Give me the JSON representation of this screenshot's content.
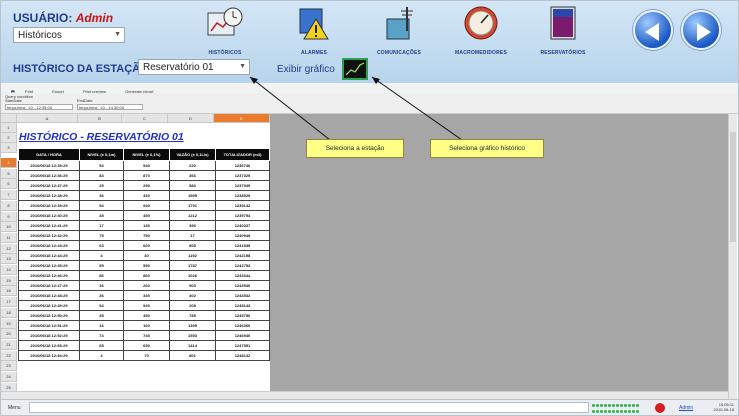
{
  "header": {
    "user_label": "USUÁRIO:",
    "user_name": "Admin",
    "screen_select": "Históricos",
    "station_title": "HISTÓRICO DA ESTAÇÃO -",
    "station_select": "Reservatório 01",
    "exibir_label": "Exibir gráfico",
    "nav": [
      {
        "label": "HISTÓRICOS",
        "icon": "history-chart-icon"
      },
      {
        "label": "ALARMES",
        "icon": "alarm-warning-icon"
      },
      {
        "label": "COMUNICAÇÕES",
        "icon": "antenna-tower-icon"
      },
      {
        "label": "MACROMEDIDORES",
        "icon": "gauge-meter-icon"
      },
      {
        "label": "RESERVATÓRIOS",
        "icon": "tank-icon"
      }
    ]
  },
  "toolbar": {
    "print": "Print",
    "export": "Export",
    "preview": "Print preview",
    "generate": "Generate report",
    "query_condition": "Query condition",
    "start_date_label": "StartDate",
    "end_date_label": "EndDate",
    "start_date": "terça-feira , 10 - 12:35:00",
    "end_date": "terça-feira , 10 - 14:30:00"
  },
  "sheet": {
    "columns": [
      "A",
      "B",
      "C",
      "D",
      "E"
    ],
    "title": "HISTÓRICO - RESERVATÓRIO 01",
    "headers": [
      "DATA / HORA",
      "NIVEL (± 0,1m)",
      "NIVEL (± 0,1%)",
      "VAZÃO (± 0,1L/s)",
      "TOTALIZADOR (m3)"
    ],
    "row_numbers": [
      "1",
      "2",
      "3",
      "4",
      "5",
      "6",
      "7",
      "8",
      "9",
      "10",
      "11",
      "12",
      "13",
      "14",
      "15",
      "16",
      "17",
      "18",
      "19",
      "20",
      "21",
      "22",
      "23",
      "24",
      "25",
      "26"
    ],
    "rows": [
      [
        "2010/06/18 12:35:29",
        "54",
        "540",
        "220",
        "1236746"
      ],
      [
        "2010/06/18 12:36:29",
        "84",
        "870",
        "366",
        "1237329"
      ],
      [
        "2010/06/18 12:37:29",
        "25",
        "250",
        "583",
        "1237949"
      ],
      [
        "2010/06/18 12:38:29",
        "36",
        "330",
        "1595",
        "1238529"
      ],
      [
        "2010/06/18 12:39:29",
        "94",
        "940",
        "1791",
        "1239142"
      ],
      [
        "2010/06/18 12:40:29",
        "45",
        "450",
        "1212",
        "1239754"
      ],
      [
        "2010/06/18 12:41:29",
        "17",
        "130",
        "396",
        "1240337"
      ],
      [
        "2010/06/18 12:42:29",
        "75",
        "750",
        "17",
        "1240949"
      ],
      [
        "2010/06/18 12:43:29",
        "63",
        "660",
        "805",
        "1241539"
      ],
      [
        "2010/06/18 12:44:29",
        "4",
        "40",
        "1192",
        "1242158"
      ],
      [
        "2010/06/18 12:45:29",
        "55",
        "550",
        "1787",
        "1242753"
      ],
      [
        "2010/06/18 12:46:29",
        "86",
        "860",
        "1026",
        "1243344"
      ],
      [
        "2010/06/18 12:47:29",
        "26",
        "260",
        "903",
        "1243940"
      ],
      [
        "2010/06/18 12:48:29",
        "36",
        "330",
        "402",
        "1244532"
      ],
      [
        "2010/06/18 12:49:29",
        "94",
        "940",
        "208",
        "1245143"
      ],
      [
        "2010/06/18 12:50:29",
        "45",
        "450",
        "785",
        "1245750"
      ],
      [
        "2010/06/18 12:51:29",
        "16",
        "160",
        "1395",
        "1246360"
      ],
      [
        "2010/06/18 12:52:29",
        "74",
        "740",
        "1593",
        "1246940"
      ],
      [
        "2010/06/18 12:53:29",
        "65",
        "650",
        "1414",
        "1247551"
      ],
      [
        "2010/06/18 12:54:29",
        "4",
        "70",
        "801",
        "1248132"
      ]
    ]
  },
  "callouts": {
    "station": "Seleciona a estação",
    "graph": "Seleciona gráfico histórico"
  },
  "status": {
    "menu": "Menu",
    "link": "Admin",
    "time": "15:05:11",
    "date": "2010-06-18"
  },
  "colors": {
    "accent_orange": "#e97b2e",
    "title_blue": "#1f30c8",
    "nav_blue": "#1f3b8f",
    "callout_yellow": "#ffff88"
  }
}
